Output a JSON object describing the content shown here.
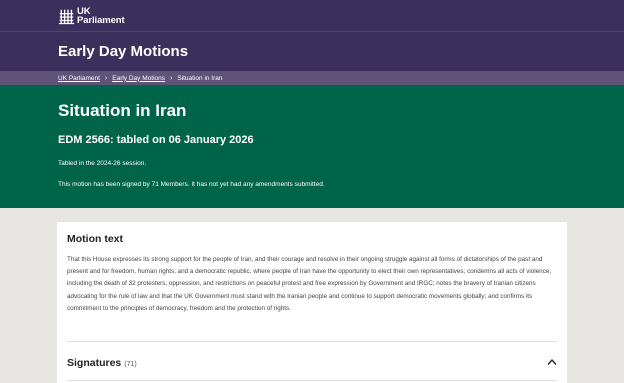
{
  "header": {
    "logo_line1": "UK",
    "logo_line2": "Parliament",
    "logo_icon": "portcullis-icon",
    "section_title": "Early Day Motions"
  },
  "breadcrumb": {
    "items": [
      "UK Parliament",
      "Early Day Motions",
      "Situation in Iran"
    ],
    "separator_icon": "chevron-right-icon"
  },
  "hero": {
    "title": "Situation in Iran",
    "subtitle": "EDM 2566: tabled on 06 January 2026",
    "session_text": "Tabled in the 2024-26 session.",
    "signed_text": "This motion has been signed by 71 Members. It has not yet had any amendments submitted."
  },
  "motion": {
    "heading": "Motion text",
    "body": "That this House expresses its strong support for the people of Iran, and their courage and resolve in their ongoing struggle against all forms of dictatorships of the past and present and for freedom, human rights, and a democratic republic, where people of Iran have the opportunity to elect their own representatives; condemns all acts of violence, including the death of 32 protesters, oppression, and restrictions on peaceful protest and free expression by Government and IRGC; notes the bravery of Iranian citizens advocating for the rule of law and that the UK Government must stand with the Iranian people and continue to support democratic movements globally; and confirms its commitment to the principles of democracy, freedom and the protection of rights."
  },
  "signatures": {
    "heading": "Signatures",
    "count": "(71)",
    "toggle_icon": "chevron-up-icon"
  },
  "colors": {
    "header_bg": "#3b2f5c",
    "breadcrumb_bg": "#5f5478",
    "hero_bg": "#006548",
    "page_bg": "#e7e5e2"
  }
}
